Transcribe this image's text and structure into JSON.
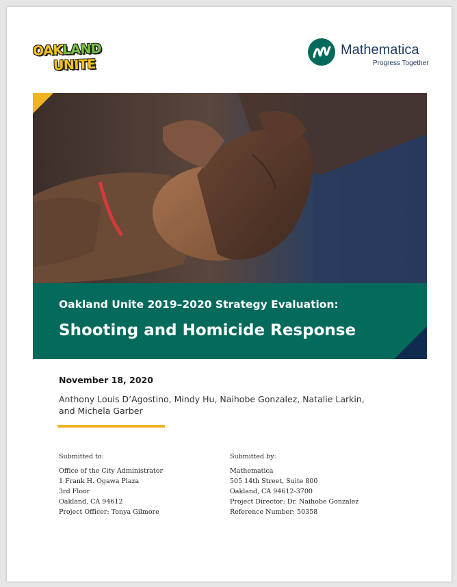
{
  "logos": {
    "oakland_unite": {
      "line1_a": "OAK",
      "line1_b": "LAND",
      "line2": "UNITE"
    },
    "mathematica": {
      "name": "Mathematica",
      "tagline": "Progress Together"
    }
  },
  "cover": {
    "photo": "hands-clasped-photo",
    "subtitle": "Oakland Unite 2019–2020 Strategy Evaluation:",
    "title": "Shooting and Homicide Response"
  },
  "date": "November 18, 2020",
  "authors": "Anthony Louis D’Agostino, Mindy Hu, Naihobe Gonzalez, Natalie Larkin, and Michela Garber",
  "submitted_to": {
    "header": "Submitted to:",
    "lines": [
      "Office of the City Administrator",
      "1 Frank H. Ogawa Plaza",
      "3rd Floor",
      "Oakland, CA 94612",
      "Project Officer: Tonya Gilmore"
    ]
  },
  "submitted_by": {
    "header": "Submitted by:",
    "lines": [
      "Mathematica",
      "505 14th Street, Suite 800",
      "Oakland, CA 94612-3700",
      "Project Director: Dr. Naihobe Gonzalez",
      "Reference Number: 50358"
    ]
  },
  "colors": {
    "brand_green": "#046b5c",
    "accent_gold": "#f0b323",
    "navy": "#0f2c4f"
  }
}
